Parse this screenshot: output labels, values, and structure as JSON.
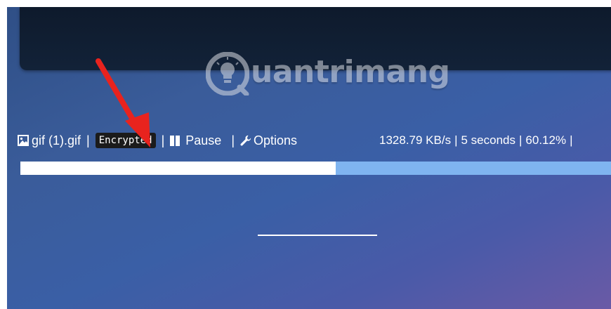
{
  "watermark": {
    "brand": "uantrimang"
  },
  "transfer": {
    "file_icon": "image-file-icon",
    "file_name": "gif (1).gif",
    "separator": "|",
    "encryption_badge": "Encrypted",
    "pause_icon": "pause-icon",
    "pause_label": "Pause",
    "options_icon": "wrench-icon",
    "options_label": "Options",
    "speed": "1328.79 KB/s",
    "time_remaining": "5 seconds",
    "percent_text": "60.12%",
    "progress_fraction": 0.5338
  },
  "colors": {
    "progress_fill": "#ffffff",
    "progress_track": "#7fb4f0",
    "badge_bg": "#1b1b1b",
    "arrow": "#e8231e"
  }
}
